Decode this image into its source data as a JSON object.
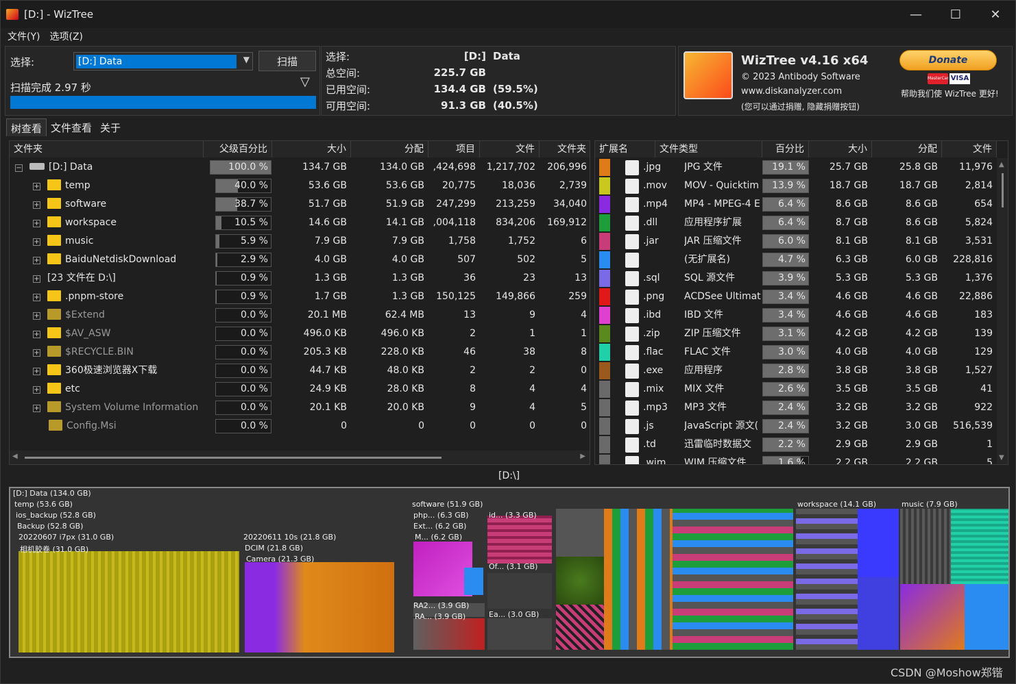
{
  "window": {
    "title": "[D:]  - WizTree",
    "min": "—",
    "max": "☐",
    "close": "✕"
  },
  "menu": [
    "文件(Y)",
    "选项(Z)"
  ],
  "select_panel": {
    "select_label": "选择:",
    "drive_value": "[D:] Data",
    "scan_button": "扫描",
    "scan_status": "扫描完成 2.97 秒",
    "filter_icon": "filter-icon",
    "progress": 1.0
  },
  "info": [
    {
      "k": "选择:",
      "v1": "[D:]",
      "v2": "Data"
    },
    {
      "k": "总空间:",
      "v1": "225.7 GB",
      "v2": ""
    },
    {
      "k": "已用空间:",
      "v1": "134.4 GB",
      "v2": "(59.5%)"
    },
    {
      "k": "可用空间:",
      "v1": "91.3 GB",
      "v2": "(40.5%)"
    }
  ],
  "about": {
    "name": "WizTree v4.16 x64",
    "copyright": "© 2023 Antibody Software",
    "url": "www.diskanalyzer.com",
    "note": "(您可以通过捐赠, 隐藏捐赠按钮)",
    "donate_label": "Donate",
    "help_text": "帮助我们使 WizTree 更好!",
    "mc": "MasterCard",
    "visa": "VISA"
  },
  "tabs": [
    "树查看",
    "文件查看",
    "关于"
  ],
  "tree_headers": [
    "文件夹",
    "父级百分比",
    "大小",
    "分配",
    "项目",
    "文件",
    "文件夹"
  ],
  "tree_rows": [
    {
      "name": "[D:] Data",
      "pct": "100.0 %",
      "pv": 1.0,
      "size": "134.7 GB",
      "alloc": "134.0 GB",
      "items": ",424,698",
      "files": "1,217,702",
      "folders": "206,996",
      "kind": "drive",
      "exp": "⊟",
      "dim": false
    },
    {
      "name": "temp",
      "pct": "40.0 %",
      "pv": 0.4,
      "size": "53.6 GB",
      "alloc": "53.6 GB",
      "items": "20,775",
      "files": "18,036",
      "folders": "2,739",
      "kind": "folder",
      "exp": "⊞",
      "dim": false
    },
    {
      "name": "software",
      "pct": "38.7 %",
      "pv": 0.387,
      "size": "51.7 GB",
      "alloc": "51.9 GB",
      "items": "247,299",
      "files": "213,259",
      "folders": "34,040",
      "kind": "folder",
      "exp": "⊞",
      "dim": false
    },
    {
      "name": "workspace",
      "pct": "10.5 %",
      "pv": 0.105,
      "size": "14.6 GB",
      "alloc": "14.1 GB",
      "items": ",004,118",
      "files": "834,206",
      "folders": "169,912",
      "kind": "folder",
      "exp": "⊞",
      "dim": false
    },
    {
      "name": "music",
      "pct": "5.9 %",
      "pv": 0.059,
      "size": "7.9 GB",
      "alloc": "7.9 GB",
      "items": "1,758",
      "files": "1,752",
      "folders": "6",
      "kind": "folder",
      "exp": "⊞",
      "dim": false
    },
    {
      "name": "BaiduNetdiskDownload",
      "pct": "2.9 %",
      "pv": 0.029,
      "size": "4.0 GB",
      "alloc": "4.0 GB",
      "items": "507",
      "files": "502",
      "folders": "5",
      "kind": "folder",
      "exp": "⊞",
      "dim": false
    },
    {
      "name": "[23 文件在 D:\\]",
      "pct": "0.9 %",
      "pv": 0.009,
      "size": "1.3 GB",
      "alloc": "1.3 GB",
      "items": "36",
      "files": "23",
      "folders": "13",
      "kind": "none",
      "exp": "⊞",
      "dim": false
    },
    {
      "name": ".pnpm-store",
      "pct": "0.9 %",
      "pv": 0.009,
      "size": "1.7 GB",
      "alloc": "1.3 GB",
      "items": "150,125",
      "files": "149,866",
      "folders": "259",
      "kind": "folder",
      "exp": "⊞",
      "dim": false
    },
    {
      "name": "$Extend",
      "pct": "0.0 %",
      "pv": 0,
      "size": "20.1 MB",
      "alloc": "62.4 MB",
      "items": "13",
      "files": "9",
      "folders": "4",
      "kind": "sys",
      "exp": "⊞",
      "dim": true
    },
    {
      "name": "$AV_ASW",
      "pct": "0.0 %",
      "pv": 0,
      "size": "496.0 KB",
      "alloc": "496.0 KB",
      "items": "2",
      "files": "1",
      "folders": "1",
      "kind": "folder",
      "exp": "⊞",
      "dim": true
    },
    {
      "name": "$RECYCLE.BIN",
      "pct": "0.0 %",
      "pv": 0,
      "size": "205.3 KB",
      "alloc": "228.0 KB",
      "items": "46",
      "files": "38",
      "folders": "8",
      "kind": "sys",
      "exp": "⊞",
      "dim": true
    },
    {
      "name": "360极速浏览器X下载",
      "pct": "0.0 %",
      "pv": 0,
      "size": "44.7 KB",
      "alloc": "48.0 KB",
      "items": "2",
      "files": "2",
      "folders": "0",
      "kind": "folder",
      "exp": "⊞",
      "dim": false
    },
    {
      "name": "etc",
      "pct": "0.0 %",
      "pv": 0,
      "size": "24.9 KB",
      "alloc": "28.0 KB",
      "items": "8",
      "files": "4",
      "folders": "4",
      "kind": "folder",
      "exp": "⊞",
      "dim": false
    },
    {
      "name": "System Volume Information",
      "pct": "0.0 %",
      "pv": 0,
      "size": "20.1 KB",
      "alloc": "20.0 KB",
      "items": "9",
      "files": "4",
      "folders": "5",
      "kind": "sys",
      "exp": "⊞",
      "dim": true
    },
    {
      "name": "Config.Msi",
      "pct": "0.0 %",
      "pv": 0,
      "size": "0",
      "alloc": "0",
      "items": "0",
      "files": "0",
      "folders": "0",
      "kind": "sys",
      "exp": "",
      "dim": true
    }
  ],
  "ext_headers": [
    "扩展名",
    "文件类型",
    "百分比",
    "大小",
    "分配",
    "文件"
  ],
  "ext_rows": [
    {
      "c": "#e07b1a",
      "ext": ".jpg",
      "type": "JPG 文件",
      "pct": "19.1 %",
      "pv": 0.191,
      "size": "25.7 GB",
      "alloc": "25.8 GB",
      "files": "11,976"
    },
    {
      "c": "#c8c81e",
      "ext": ".mov",
      "type": "MOV - Quicktim",
      "pct": "13.9 %",
      "pv": 0.139,
      "size": "18.7 GB",
      "alloc": "18.7 GB",
      "files": "2,814"
    },
    {
      "c": "#8a2be2",
      "ext": ".mp4",
      "type": "MP4 - MPEG-4 E",
      "pct": "6.4 %",
      "pv": 0.064,
      "size": "8.6 GB",
      "alloc": "8.6 GB",
      "files": "654"
    },
    {
      "c": "#1e9e3a",
      "ext": ".dll",
      "type": "应用程序扩展",
      "pct": "6.4 %",
      "pv": 0.064,
      "size": "8.7 GB",
      "alloc": "8.6 GB",
      "files": "5,824"
    },
    {
      "c": "#c83c78",
      "ext": ".jar",
      "type": "JAR 压缩文件",
      "pct": "6.0 %",
      "pv": 0.06,
      "size": "8.1 GB",
      "alloc": "8.1 GB",
      "files": "3,531"
    },
    {
      "c": "#2a8cf0",
      "ext": "",
      "type": "(无扩展名)",
      "pct": "4.7 %",
      "pv": 0.047,
      "size": "6.3 GB",
      "alloc": "6.0 GB",
      "files": "228,816"
    },
    {
      "c": "#7a6ae6",
      "ext": ".sql",
      "type": "SQL 源文件",
      "pct": "3.9 %",
      "pv": 0.039,
      "size": "5.3 GB",
      "alloc": "5.3 GB",
      "files": "1,376"
    },
    {
      "c": "#e01818",
      "ext": ".png",
      "type": "ACDSee Ultimat",
      "pct": "3.4 %",
      "pv": 0.034,
      "size": "4.6 GB",
      "alloc": "4.6 GB",
      "files": "22,886"
    },
    {
      "c": "#e040d0",
      "ext": ".ibd",
      "type": "IBD 文件",
      "pct": "3.4 %",
      "pv": 0.034,
      "size": "4.6 GB",
      "alloc": "4.6 GB",
      "files": "183"
    },
    {
      "c": "#5a8a1e",
      "ext": ".zip",
      "type": "ZIP 压缩文件",
      "pct": "3.1 %",
      "pv": 0.031,
      "size": "4.2 GB",
      "alloc": "4.2 GB",
      "files": "139"
    },
    {
      "c": "#20d0a8",
      "ext": ".flac",
      "type": "FLAC 文件",
      "pct": "3.0 %",
      "pv": 0.03,
      "size": "4.0 GB",
      "alloc": "4.0 GB",
      "files": "129"
    },
    {
      "c": "#9a5a1e",
      "ext": ".exe",
      "type": "应用程序",
      "pct": "2.8 %",
      "pv": 0.028,
      "size": "3.8 GB",
      "alloc": "3.8 GB",
      "files": "1,527"
    },
    {
      "c": "#6a6a6a",
      "ext": ".mix",
      "type": "MIX 文件",
      "pct": "2.6 %",
      "pv": 0.026,
      "size": "3.5 GB",
      "alloc": "3.5 GB",
      "files": "41"
    },
    {
      "c": "#6a6a6a",
      "ext": ".mp3",
      "type": "MP3 文件",
      "pct": "2.4 %",
      "pv": 0.024,
      "size": "3.2 GB",
      "alloc": "3.2 GB",
      "files": "922"
    },
    {
      "c": "#6a6a6a",
      "ext": ".js",
      "type": "JavaScript 源文(",
      "pct": "2.4 %",
      "pv": 0.024,
      "size": "3.2 GB",
      "alloc": "3.0 GB",
      "files": "516,539"
    },
    {
      "c": "#6a6a6a",
      "ext": ".td",
      "type": "迅雷临时数据文",
      "pct": "2.2 %",
      "pv": 0.022,
      "size": "2.9 GB",
      "alloc": "2.9 GB",
      "files": "1"
    },
    {
      "c": "#6a6a6a",
      "ext": ".wim",
      "type": "WIM 压缩文件",
      "pct": "1.6 %",
      "pv": 0.016,
      "size": "2.2 GB",
      "alloc": "2.2 GB",
      "files": "5"
    }
  ],
  "path_label": "[D:\\]",
  "treemap_labels": [
    "[D:] Data  (134.0 GB)",
    "temp  (53.6 GB)",
    "ios_backup  (52.8 GB)",
    "Backup  (52.8 GB)",
    "20220607 i7px  (31.0 GB)",
    "相机胶卷  (31.0 GB)",
    "20220611 10s  (21.8 GB)",
    "DCIM  (21.8 GB)",
    "Camera  (21.3 GB)",
    "software  (51.9 GB)",
    "php...  (6.3 GB)",
    "Ext...  (6.2 GB)",
    "M...  (6.2 GB)",
    "id...  (3.3 GB)",
    "Of...  (3.1 GB)",
    "RA2...  (3.9 GB)",
    "RA...  (3.9 GB)",
    "Ea...  (3.0 GB)",
    "workspace  (14.1 GB)",
    "music  (7.9 GB)"
  ],
  "watermark": "CSDN @Moshow郑锴"
}
